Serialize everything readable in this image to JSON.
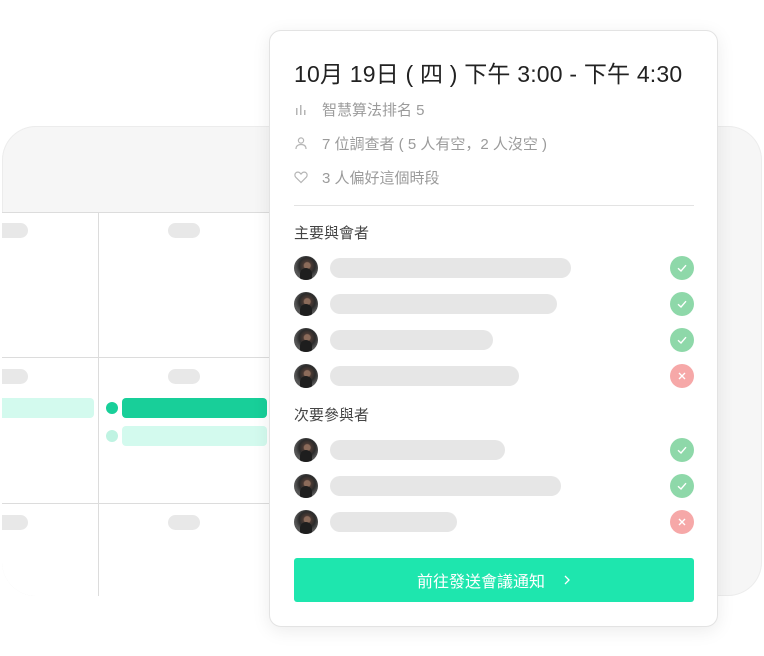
{
  "popup": {
    "title": "10月 19日 ( 四 )  下午 3:00 - 下午 4:30",
    "meta": {
      "rank_text": "智慧算法排名 5",
      "respondents_text": "7 位調查者 ( 5 人有空，2 人沒空 )",
      "preference_text": "3 人偏好這個時段"
    },
    "primary_label": "主要與會者",
    "secondary_label": "次要參與者",
    "primary_attendees": [
      {
        "status": "available",
        "icon": "check-icon"
      },
      {
        "status": "available",
        "icon": "check-icon"
      },
      {
        "status": "available",
        "icon": "check-icon"
      },
      {
        "status": "unavailable",
        "icon": "close-icon"
      }
    ],
    "secondary_attendees": [
      {
        "status": "available",
        "icon": "check-icon"
      },
      {
        "status": "available",
        "icon": "check-icon"
      },
      {
        "status": "unavailable",
        "icon": "close-icon"
      }
    ],
    "cta_label": "前往發送會議通知"
  },
  "colors": {
    "accent": "#1ee6ae",
    "available": "#8ed8a9",
    "unavailable": "#f6a8a8",
    "event_primary": "#18cf99",
    "event_secondary": "#d3faee"
  },
  "icons": {
    "rank": "bar-chart-icon",
    "respondents": "person-icon",
    "preference": "heart-icon",
    "cta": "chevron-right-icon"
  }
}
